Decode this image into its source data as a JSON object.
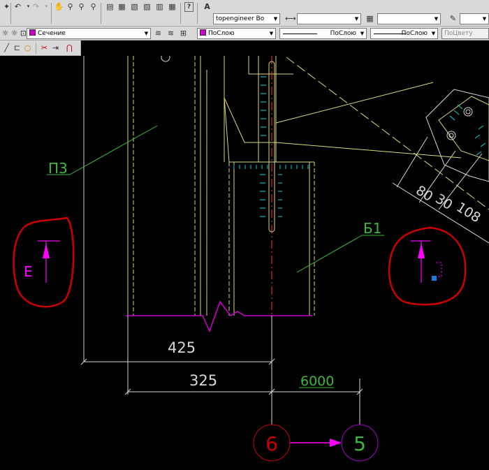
{
  "toolbar": {
    "text_style": "topengineer Bo",
    "dim_style": "",
    "table_style": "",
    "layer": "Сечение",
    "color": "ПоСлою",
    "linetype": "ПоСлою",
    "lineweight": "ПоСлою",
    "plotstyle": "ПоЦвету",
    "colors": {
      "layer_swatch": "#cc00cc",
      "color_swatch": "#cc00cc"
    }
  },
  "drawing": {
    "labels": {
      "p3": "П3",
      "b1": "Б1",
      "section_e": "Е"
    },
    "dimensions": {
      "d425": "425",
      "d325": "325",
      "d6000": "6000",
      "d80": "80",
      "d30": "30",
      "d108": "108"
    },
    "grid_axes": {
      "axis6": "6",
      "axis5": "5"
    },
    "colors": {
      "background": "#000000",
      "structure": "#d8d880",
      "dimension": "#d8d8d8",
      "leader": "#3cb83c",
      "section_mark": "#ff00ff",
      "hatch": "#00d8d8",
      "centerline": "#ff3030",
      "axis6": "#c80000",
      "axis5": "#a000c8",
      "annotation_circle": "#cc0000"
    }
  }
}
